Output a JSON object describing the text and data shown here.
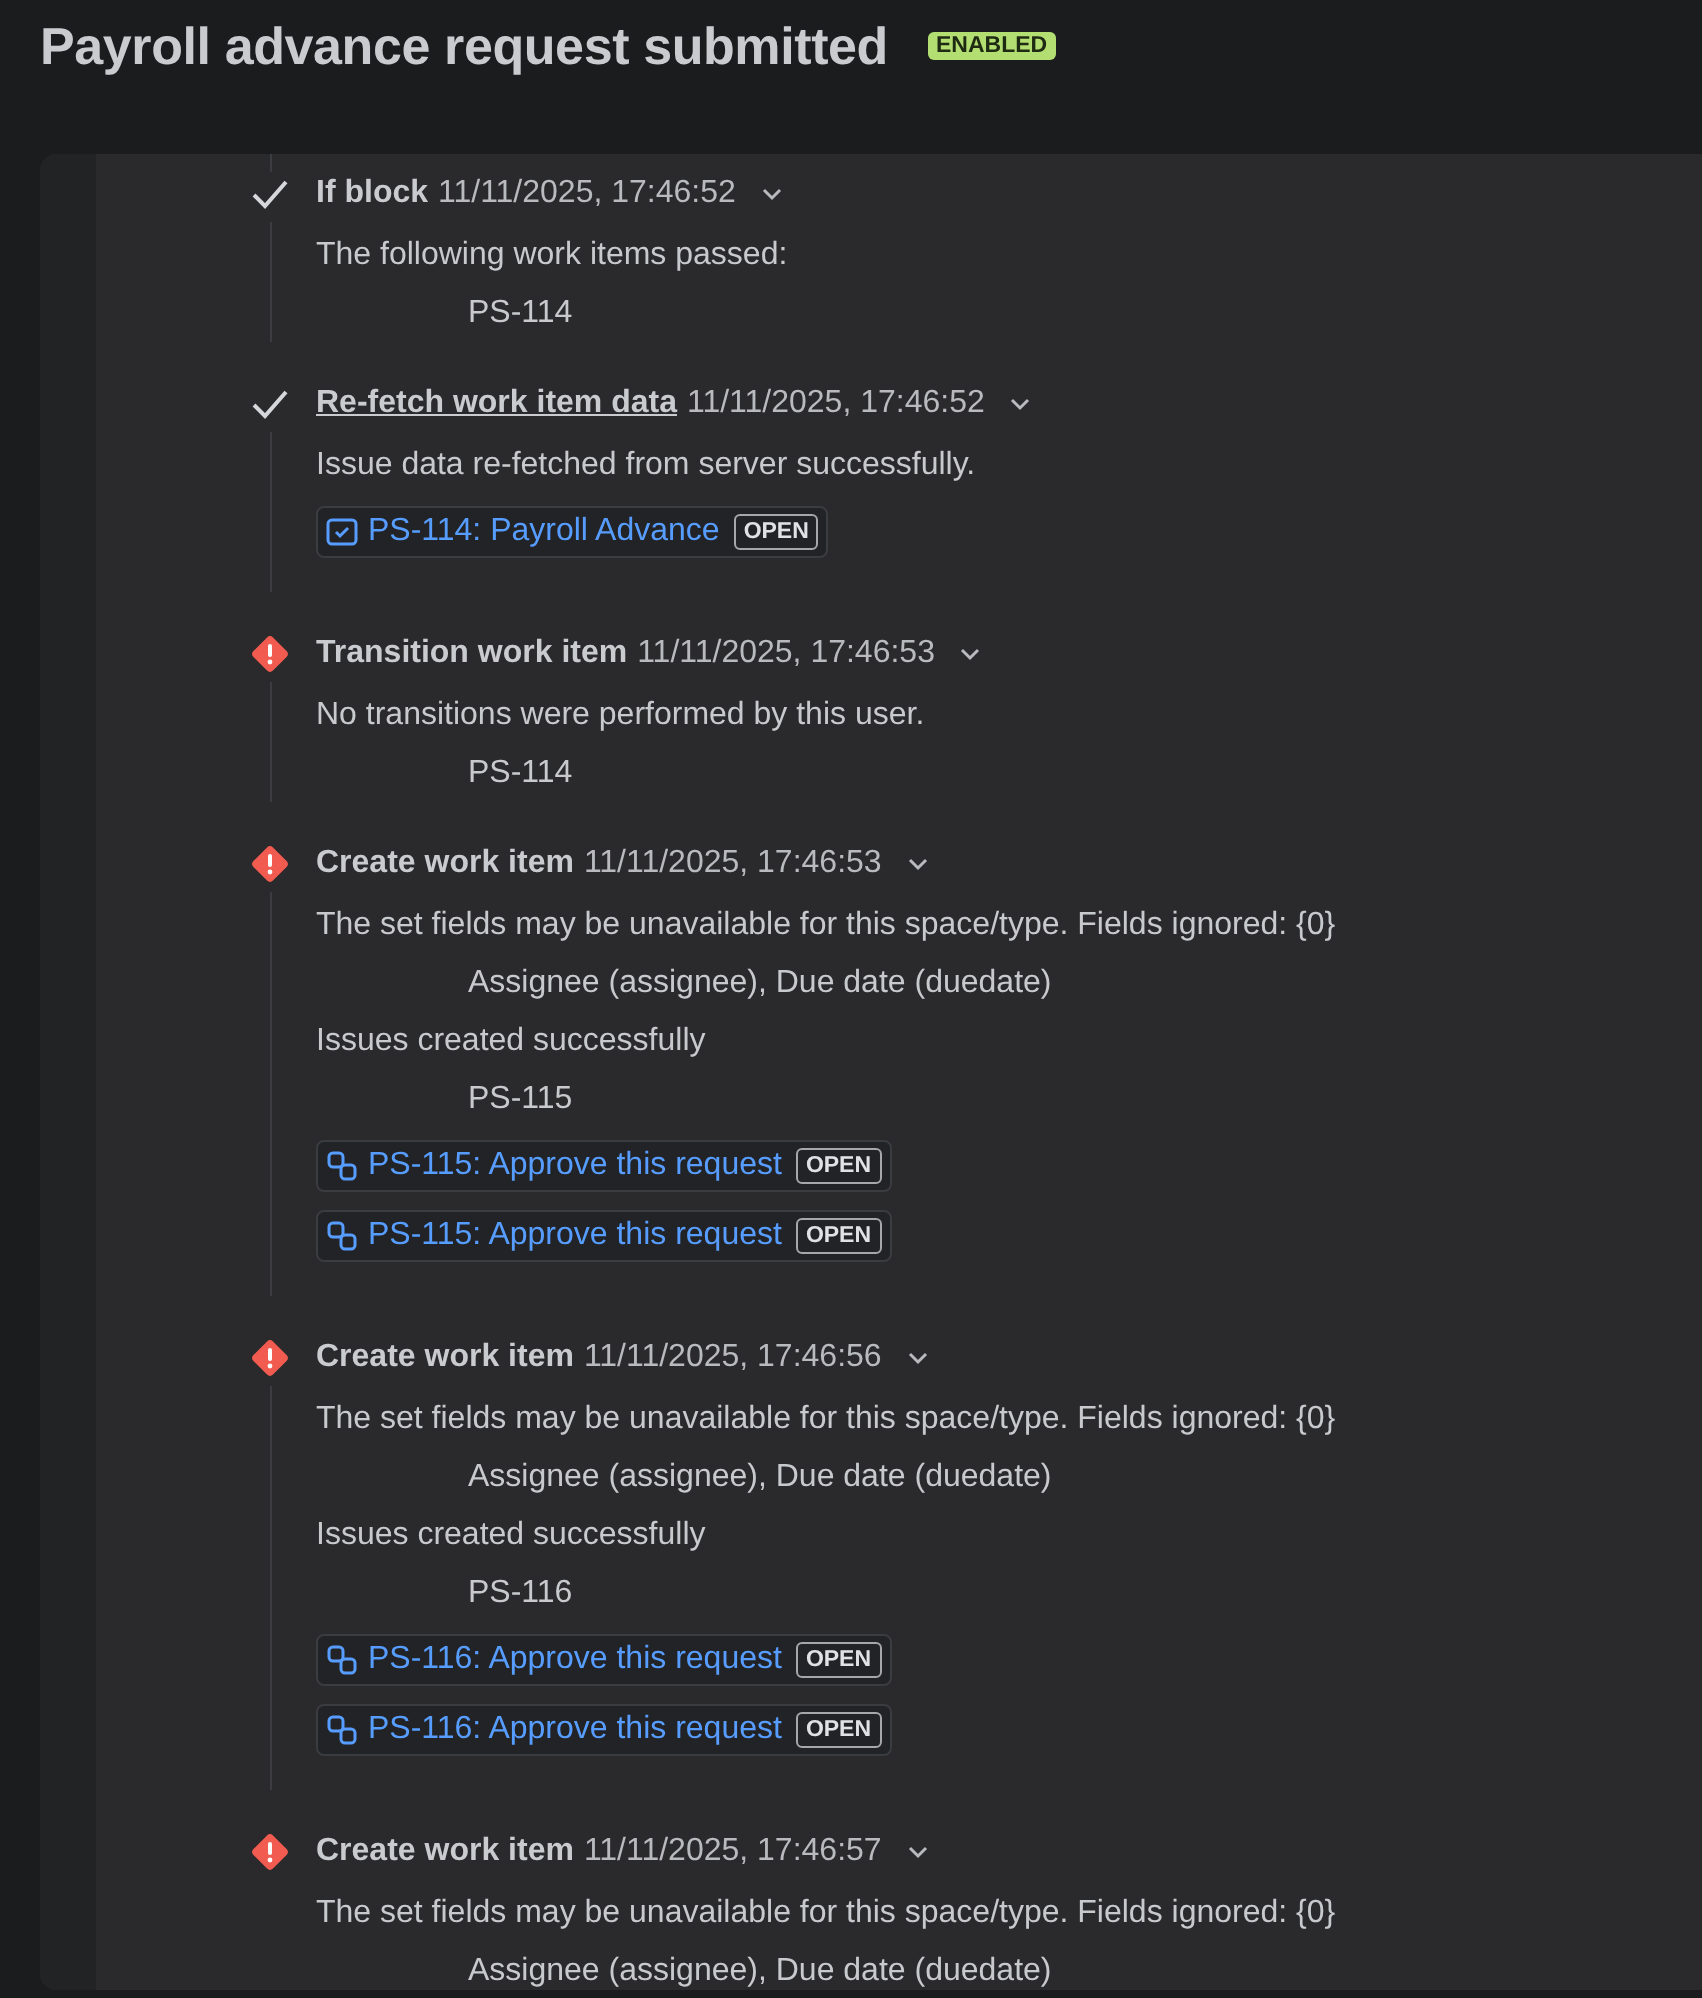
{
  "header": {
    "title": "Payroll advance request submitted",
    "badge": "ENABLED"
  },
  "entries": [
    {
      "kind": "success",
      "title": "If block",
      "title_link": false,
      "timestamp": "11/11/2025, 17:46:52",
      "items": [
        {
          "kind": "line",
          "text": "The following work items passed:"
        },
        {
          "kind": "indented",
          "text": "PS-114"
        }
      ]
    },
    {
      "kind": "success",
      "title": "Re-fetch work item data",
      "title_link": true,
      "timestamp": "11/11/2025, 17:46:52",
      "items": [
        {
          "kind": "line",
          "text": "Issue data re-fetched from server successfully."
        },
        {
          "kind": "task",
          "text": "PS-114: Payroll Advance",
          "lozenge": "OPEN"
        }
      ]
    },
    {
      "kind": "error",
      "title": "Transition work item",
      "title_link": false,
      "timestamp": "11/11/2025, 17:46:53",
      "items": [
        {
          "kind": "line",
          "text": "No transitions were performed by this user."
        },
        {
          "kind": "indented",
          "text": "PS-114"
        }
      ]
    },
    {
      "kind": "error",
      "title": "Create work item",
      "title_link": false,
      "timestamp": "11/11/2025, 17:46:53",
      "items": [
        {
          "kind": "line",
          "text": "The set fields may be unavailable for this space/type. Fields ignored: {0}"
        },
        {
          "kind": "indented",
          "text": "Assignee (assignee), Due date (duedate)"
        },
        {
          "kind": "line",
          "text": "Issues created successfully"
        },
        {
          "kind": "indented",
          "text": "PS-115"
        },
        {
          "kind": "subtask",
          "text": "PS-115: Approve this request",
          "lozenge": "OPEN"
        },
        {
          "kind": "subtask",
          "text": "PS-115: Approve this request",
          "lozenge": "OPEN"
        }
      ]
    },
    {
      "kind": "error",
      "title": "Create work item",
      "title_link": false,
      "timestamp": "11/11/2025, 17:46:56",
      "items": [
        {
          "kind": "line",
          "text": "The set fields may be unavailable for this space/type. Fields ignored: {0}"
        },
        {
          "kind": "indented",
          "text": "Assignee (assignee), Due date (duedate)"
        },
        {
          "kind": "line",
          "text": "Issues created successfully"
        },
        {
          "kind": "indented",
          "text": "PS-116"
        },
        {
          "kind": "subtask",
          "text": "PS-116: Approve this request",
          "lozenge": "OPEN"
        },
        {
          "kind": "subtask",
          "text": "PS-116: Approve this request",
          "lozenge": "OPEN"
        }
      ]
    },
    {
      "kind": "error",
      "title": "Create work item",
      "title_link": false,
      "timestamp": "11/11/2025, 17:46:57",
      "items": [
        {
          "kind": "line",
          "text": "The set fields may be unavailable for this space/type. Fields ignored: {0}"
        },
        {
          "kind": "indented",
          "text": "Assignee (assignee), Due date (duedate)"
        }
      ]
    }
  ]
}
